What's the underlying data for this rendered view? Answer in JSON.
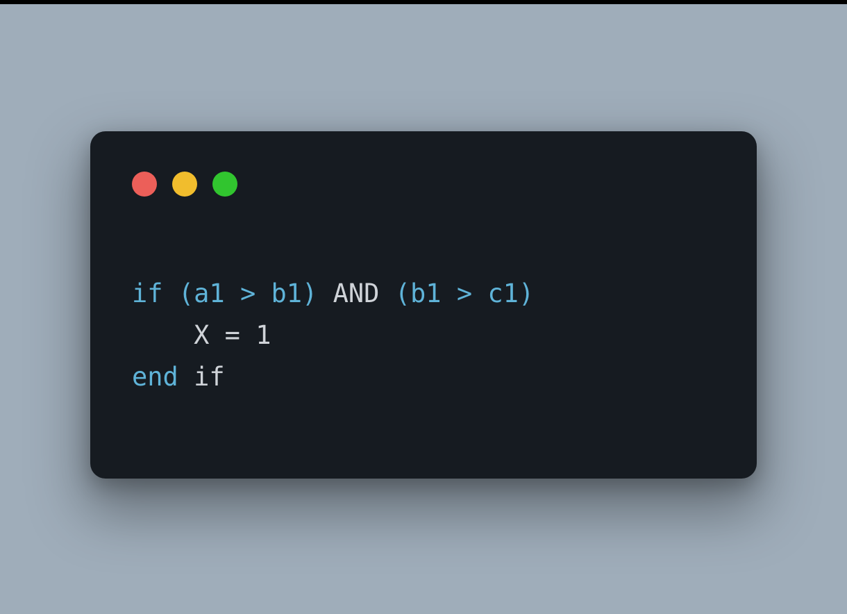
{
  "colors": {
    "background": "#9fadba",
    "window_bg": "#161b21",
    "traffic_red": "#ec5f59",
    "traffic_yellow": "#f1bd2d",
    "traffic_green": "#31c52f",
    "keyword": "#5fb3d8",
    "text": "#cfd3d8"
  },
  "traffic_lights": {
    "red": "close-icon",
    "yellow": "minimize-icon",
    "green": "maximize-icon"
  },
  "code": {
    "line1": {
      "t1": "if",
      "t2": " (a1 ",
      "t3": ">",
      "t4": " b1)",
      "t5": " AND ",
      "t6": "(b1 ",
      "t7": ">",
      "t8": " c1)"
    },
    "line2": {
      "indent": "    ",
      "t1": "X",
      "t2": " = ",
      "t3": "1"
    },
    "line3": {
      "t1": "end",
      "t2": " ",
      "t3": "if"
    }
  }
}
